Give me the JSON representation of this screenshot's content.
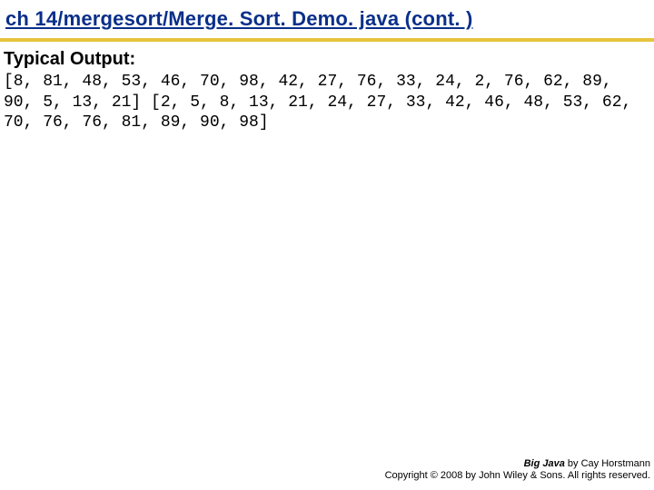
{
  "title": "ch 14/mergesort/Merge. Sort. Demo. java  (cont. )",
  "subhead": "Typical Output:",
  "output_text": "[8, 81, 48, 53, 46, 70, 98, 42, 27, 76, 33, 24, 2, 76, 62, 89, 90, 5, 13, 21] [2, 5, 8, 13, 21, 24, 27, 33, 42, 46, 48, 53, 62, 70, 76, 76, 81, 89, 90, 98]",
  "footer": {
    "book_title": "Big Java",
    "byline": " by Cay Horstmann",
    "copyright": "Copyright © 2008 by John Wiley & Sons.  All rights reserved."
  }
}
